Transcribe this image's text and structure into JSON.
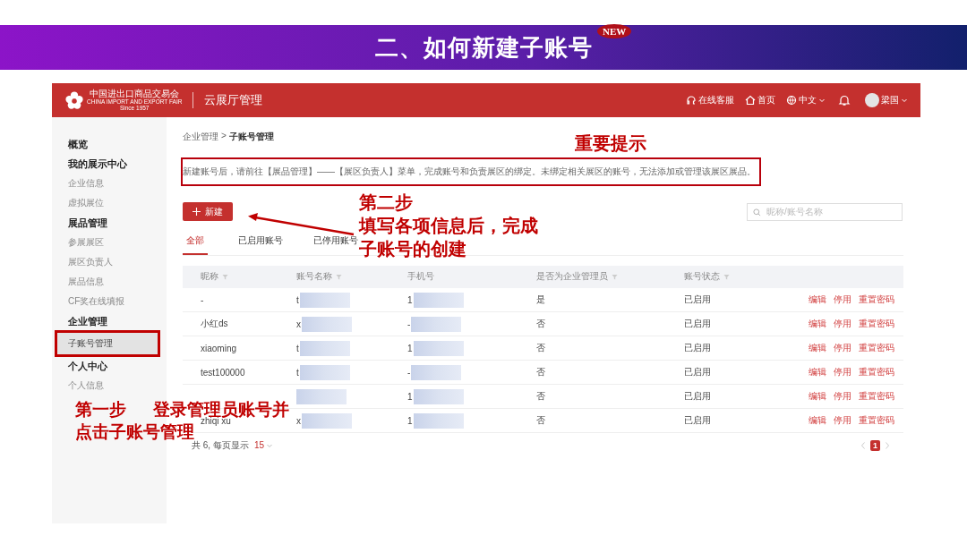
{
  "slide": {
    "title": "二、如何新建子账号",
    "badge": "NEW"
  },
  "app": {
    "logo": {
      "name": "中国进出口商品交易会",
      "caption": "CHINA IMPORT AND EXPORT FAIR",
      "since": "Since 1957"
    },
    "title": "云展厅管理",
    "nav": [
      {
        "label": "在线客服",
        "dropdown": false
      },
      {
        "label": "首页",
        "dropdown": false
      },
      {
        "label": "中文",
        "dropdown": true
      }
    ],
    "user": {
      "name": "梁国"
    }
  },
  "sidebar": {
    "items": [
      {
        "kind": "heading",
        "label": "概览",
        "selected": false,
        "highlighted": false
      },
      {
        "kind": "heading",
        "label": "我的展示中心",
        "selected": false,
        "highlighted": false
      },
      {
        "kind": "link",
        "label": "企业信息",
        "selected": false,
        "highlighted": false
      },
      {
        "kind": "link",
        "label": "虚拟展位",
        "selected": false,
        "highlighted": false
      },
      {
        "kind": "heading",
        "label": "展品管理",
        "selected": false,
        "highlighted": false
      },
      {
        "kind": "link",
        "label": "参展展区",
        "selected": false,
        "highlighted": false
      },
      {
        "kind": "link",
        "label": "展区负责人",
        "selected": false,
        "highlighted": false
      },
      {
        "kind": "link",
        "label": "展品信息",
        "selected": false,
        "highlighted": false
      },
      {
        "kind": "link",
        "label": "CF奖在线填报",
        "selected": false,
        "highlighted": false
      },
      {
        "kind": "heading",
        "label": "企业管理",
        "selected": false,
        "highlighted": false
      },
      {
        "kind": "link",
        "label": "子账号管理",
        "selected": true,
        "highlighted": true
      },
      {
        "kind": "heading",
        "label": "个人中心",
        "selected": false,
        "highlighted": false
      },
      {
        "kind": "link",
        "label": "个人信息",
        "selected": false,
        "highlighted": false
      }
    ]
  },
  "breadcrumb": {
    "parent": "企业管理",
    "separator": ">",
    "current": "子账号管理"
  },
  "notice": {
    "text": "新建账号后，请前往【展品管理】——【展区负责人】菜单，完成账号和负责展区的绑定。未绑定相关展区的账号，无法添加或管理该展区展品。",
    "highlighted": true
  },
  "new_button": "新建",
  "search": {
    "placeholder": "昵称/账号名称"
  },
  "tabs": [
    {
      "label": "全部",
      "selected": true
    },
    {
      "label": "已启用账号",
      "selected": false
    },
    {
      "label": "已停用账号",
      "selected": false
    }
  ],
  "table": {
    "columns": [
      {
        "label": "昵称",
        "filter": true
      },
      {
        "label": "账号名称",
        "filter": true
      },
      {
        "label": "手机号",
        "filter": false
      },
      {
        "label": "是否为企业管理员",
        "filter": true
      },
      {
        "label": "账号状态",
        "filter": true
      }
    ],
    "rows": [
      {
        "nickname": "-",
        "account": "t",
        "phone": "1",
        "admin": "是",
        "status": "已启用",
        "actions": [
          "编辑",
          "停用",
          "重置密码"
        ]
      },
      {
        "nickname": "小红ds",
        "account": "x",
        "phone": "-",
        "admin": "否",
        "status": "已启用",
        "actions": [
          "编辑",
          "停用",
          "重置密码"
        ]
      },
      {
        "nickname": "xiaoming",
        "account": "t",
        "phone": "1",
        "admin": "否",
        "status": "已启用",
        "actions": [
          "编辑",
          "停用",
          "重置密码"
        ]
      },
      {
        "nickname": "test100000",
        "account": "t",
        "phone": "-",
        "admin": "否",
        "status": "已启用",
        "actions": [
          "编辑",
          "停用",
          "重置密码"
        ]
      },
      {
        "phone": "1",
        "admin": "否",
        "status": "已启用",
        "actions": [
          "编辑",
          "停用",
          "重置密码"
        ]
      },
      {
        "nickname": "zhiqi xu",
        "account": "x",
        "phone": "1",
        "admin": "否",
        "status": "已启用",
        "actions": [
          "编辑",
          "停用",
          "重置密码"
        ]
      }
    ]
  },
  "pagination": {
    "total": "共 6, 每页显示",
    "page_size": "15",
    "pages": [
      {
        "label": "1",
        "selected": true
      }
    ]
  },
  "annotations": {
    "important": "重要提示",
    "step2": [
      "第二步",
      "填写各项信息后，完成",
      "子账号的创建"
    ],
    "step1": {
      "title": "第一步",
      "lines": [
        "登录管理员账号并",
        "点击子账号管理"
      ]
    }
  }
}
